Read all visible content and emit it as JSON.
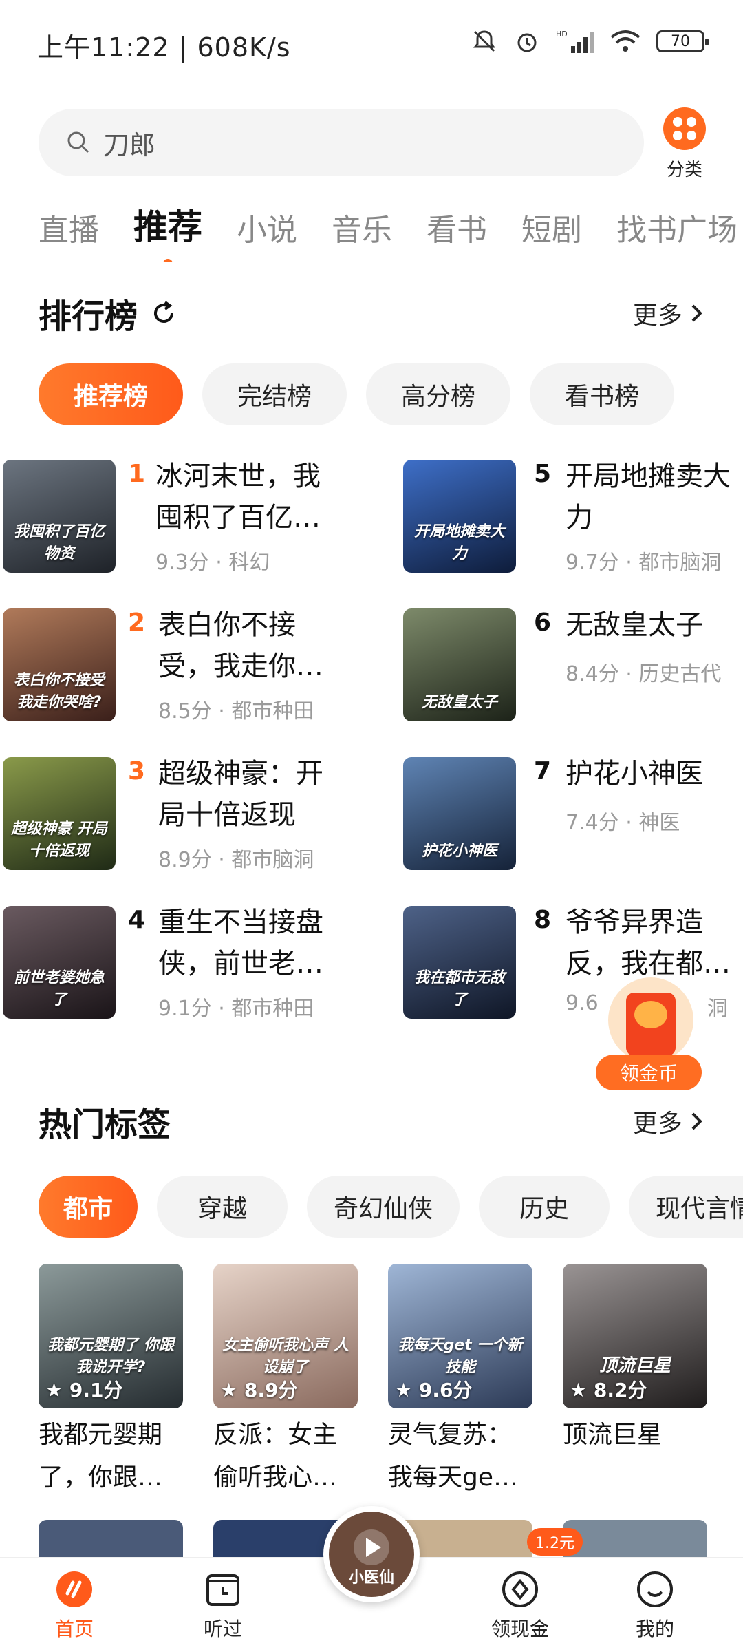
{
  "status_bar": {
    "time": "上午11:22 | 608K/s",
    "battery": "70",
    "network_label": "HD"
  },
  "search": {
    "query": "刀郎"
  },
  "category": {
    "label": "分类"
  },
  "tabs": [
    "直播",
    "推荐",
    "小说",
    "音乐",
    "看书",
    "短剧",
    "找书广场"
  ],
  "active_tab": "推荐",
  "ranking": {
    "title": "排行榜",
    "more": "更多",
    "pills": [
      "推荐榜",
      "完结榜",
      "高分榜",
      "看书榜"
    ],
    "items": [
      {
        "rank": "1",
        "title_l1": "冰河末世，我",
        "title_l2": "囤积了百亿…",
        "meta": "9.3分 · 科幻",
        "cover_text": "我囤积了百亿物资",
        "cover_color": "#2b2f36"
      },
      {
        "rank": "2",
        "title_l1": "表白你不接",
        "title_l2": "受，我走你…",
        "meta": "8.5分 · 都市种田",
        "cover_text": "表白你不接受 我走你哭啥?",
        "cover_color": "#7a4a3a"
      },
      {
        "rank": "3",
        "title_l1": "超级神豪：开",
        "title_l2": "局十倍返现",
        "meta": "8.9分 · 都市脑洞",
        "cover_text": "超级神豪 开局十倍返现",
        "cover_color": "#4d5a2a"
      },
      {
        "rank": "4",
        "title_l1": "重生不当接盘",
        "title_l2": "侠，前世老…",
        "meta": "9.1分 · 都市种田",
        "cover_text": "前世老婆她急了",
        "cover_color": "#3a3338"
      },
      {
        "rank": "5",
        "title_l1": "开局地摊卖大",
        "title_l2": "力",
        "meta": "9.7分 · 都市脑洞",
        "cover_text": "开局地摊卖大力",
        "cover_color": "#1f3f7a"
      },
      {
        "rank": "6",
        "title_l1": "无敌皇太子",
        "title_l2": "",
        "meta": "8.4分 · 历史古代",
        "cover_text": "无敌皇太子",
        "cover_color": "#3c4a3a"
      },
      {
        "rank": "7",
        "title_l1": "护花小神医",
        "title_l2": "",
        "meta": "7.4分 · 神医",
        "cover_text": "护花小神医",
        "cover_color": "#2a3f5a"
      },
      {
        "rank": "8",
        "title_l1": "爷爷异界造",
        "title_l2": "反，我在都…",
        "meta": "9.6",
        "cover_text": "我在都市无敌了",
        "cover_color": "#23304a"
      }
    ],
    "meta_tail_8": "洞"
  },
  "coin_float": {
    "label": "领金币"
  },
  "hot_tags": {
    "title": "热门标签",
    "more": "更多",
    "pills": [
      "都市",
      "穿越",
      "奇幻仙侠",
      "历史",
      "现代言情"
    ],
    "books": [
      {
        "score": "★ 9.1分",
        "title_l1": "我都元婴期",
        "title_l2": "了，你跟…",
        "cover_text": "我都元婴期了 你跟我说开学?",
        "cover_color": "#4a5560"
      },
      {
        "score": "★ 8.9分",
        "title_l1": "反派：女主",
        "title_l2": "偷听我心…",
        "cover_text": "女主偷听我心声 人设崩了",
        "cover_color": "#c9a89a"
      },
      {
        "score": "★ 9.6分",
        "title_l1": "灵气复苏：",
        "title_l2": "我每天ge…",
        "cover_text": "我每天get 一个新技能",
        "cover_color": "#5a6f8a"
      },
      {
        "score": "★ 8.2分",
        "title_l1": "顶流巨星",
        "title_l2": "",
        "cover_text": "顶流巨星",
        "cover_color": "#3d3a3a"
      }
    ]
  },
  "bottom_nav": {
    "items": [
      "首页",
      "听过",
      "领现金",
      "我的"
    ],
    "active": "首页",
    "player_caption": "小医仙",
    "badge": "1.2元"
  },
  "colors": {
    "accent": "#ff5a1a",
    "rank_top": "#ff6a1f"
  }
}
